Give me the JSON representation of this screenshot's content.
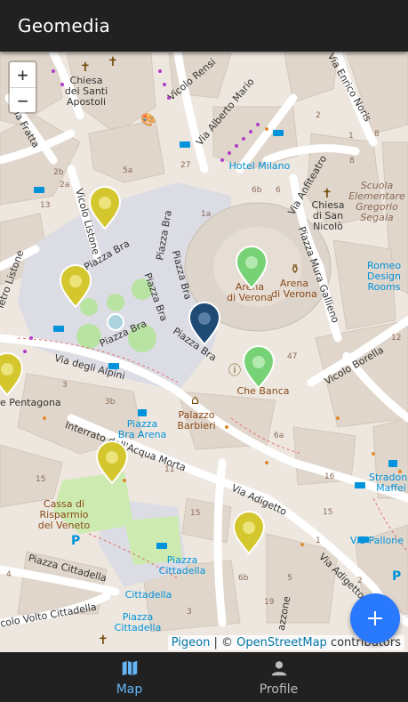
{
  "app": {
    "title": "Geomedia"
  },
  "map": {
    "zoom_in": "+",
    "zoom_out": "−",
    "attribution": {
      "leaflet": "Pigeon",
      "sep": " | © ",
      "osm": "OpenStreetMap",
      "suffix": " contributors"
    },
    "labels": {
      "chiesa_apostoli": [
        "Chiesa",
        "dei Santi",
        "Apostoli"
      ],
      "vicolo_rensi": "Vicolo Rensi",
      "via_enrico_noris": "Via Enrico Noris",
      "via_alberto_mario": "Via Alberto Mario",
      "via_fratta": "Via Fratta",
      "hotel_milano": "Hotel Milano",
      "via_anfiteatro": "Via Anfiteatro",
      "scuola": [
        "Scuola",
        "Elementare",
        "Gregorio",
        "Segala"
      ],
      "chiesa_nicolo": [
        "Chiesa",
        "di San",
        "Nicolò"
      ],
      "vicolo_listone": "Vicolo Listone",
      "piazza_bra": "Piazza Bra",
      "arena_left": [
        "Arena",
        "di Verona"
      ],
      "arena_right": [
        "Arena",
        "di Verona"
      ],
      "piazza_mura_gallieno": "Piazza Mura Gallieno",
      "romeo_rooms": [
        "Romeo",
        "Design",
        "Rooms"
      ],
      "listone": "ietro Listone",
      "via_degli_alpini": "Via degli Alpini",
      "che_banca": "Che Banca",
      "vicolo_borella": "Vicolo Borella",
      "torre_pentagona": "rre Pentagona",
      "palazzo_barbieri": [
        "Palazzo",
        "Barbieri"
      ],
      "piazza_bra_arena": [
        "Piazza",
        "Bra Arena"
      ],
      "interrato": "Interrato dell'Acqua Morta",
      "via_adigetto": "Via Adigetto",
      "stradone_maffei": [
        "Stradone",
        "Maffei"
      ],
      "cassa": [
        "Cassa di",
        "Risparmio",
        "del Veneto"
      ],
      "via_pallone": "Via Pallone",
      "piazza_cittadella": "Piazza Cittadella",
      "piazza_cittadella_2": [
        "Piazza",
        "Cittadella"
      ],
      "cittadella": "Cittadella",
      "piazza_cittadella_3": [
        "Piazza",
        "Cittadella"
      ],
      "vicolo_volto": "colo Volto Cittadella",
      "via_adigetto_2": "Via Adigetto",
      "piazzone": "azzone"
    },
    "markers": [
      {
        "name": "marker-yellow-1",
        "color": "#d4c72e"
      },
      {
        "name": "marker-yellow-2",
        "color": "#d4c72e"
      },
      {
        "name": "marker-yellow-3",
        "color": "#d4c72e"
      },
      {
        "name": "marker-yellow-4",
        "color": "#d4c72e"
      },
      {
        "name": "marker-yellow-5",
        "color": "#d4c72e"
      },
      {
        "name": "marker-green-1",
        "color": "#76d275"
      },
      {
        "name": "marker-green-2",
        "color": "#76d275"
      },
      {
        "name": "marker-navy-1",
        "color": "#1e4a73"
      }
    ]
  },
  "fab": {
    "icon": "plus-icon",
    "color": "#2979ff"
  },
  "bottom_nav": {
    "items": [
      {
        "label": "Map",
        "icon": "map-icon",
        "active": true,
        "color": "#64b5f6"
      },
      {
        "label": "Profile",
        "icon": "person-icon",
        "active": false,
        "color": "#bdbdbd"
      }
    ]
  }
}
